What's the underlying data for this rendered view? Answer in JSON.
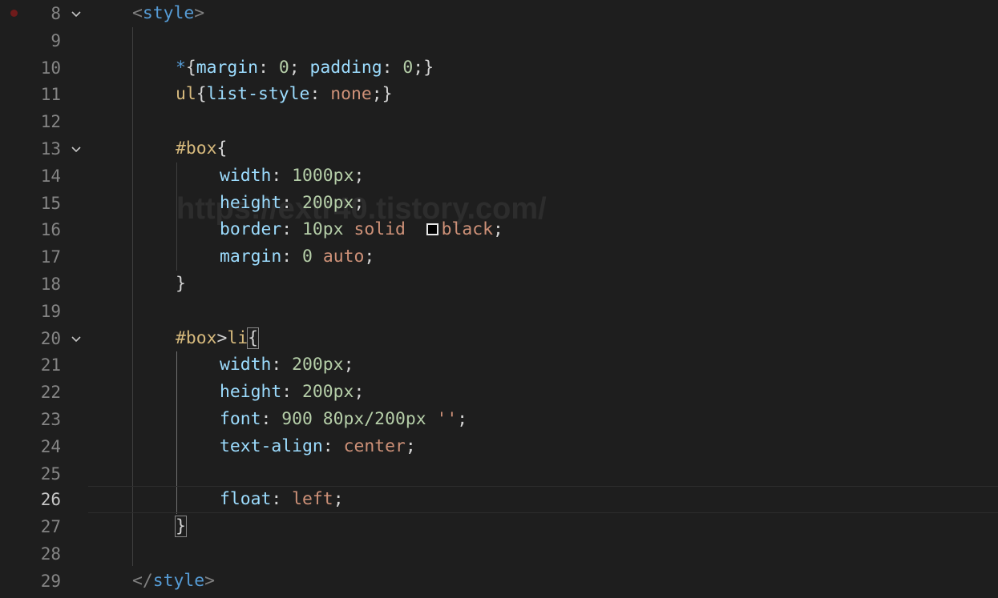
{
  "editor": {
    "active_line": "26",
    "watermark": "https://extr40.tistory.com/",
    "lines": [
      {
        "num": "8"
      },
      {
        "num": "9"
      },
      {
        "num": "10"
      },
      {
        "num": "11"
      },
      {
        "num": "12"
      },
      {
        "num": "13"
      },
      {
        "num": "14"
      },
      {
        "num": "15"
      },
      {
        "num": "16"
      },
      {
        "num": "17"
      },
      {
        "num": "18"
      },
      {
        "num": "19"
      },
      {
        "num": "20"
      },
      {
        "num": "21"
      },
      {
        "num": "22"
      },
      {
        "num": "23"
      },
      {
        "num": "24"
      },
      {
        "num": "25"
      },
      {
        "num": "26"
      },
      {
        "num": "27"
      },
      {
        "num": "28"
      },
      {
        "num": "29"
      }
    ],
    "tokens": {
      "l8_open": "<",
      "l8_tag": "style",
      "l8_close": ">",
      "l10_star": "*",
      "l10_b1": "{",
      "l10_p1": "margin",
      "l10_c1": ": ",
      "l10_n1": "0",
      "l10_s1": "; ",
      "l10_p2": "padding",
      "l10_c2": ": ",
      "l10_n2": "0",
      "l10_s2": ";",
      "l10_b2": "}",
      "l11_sel": "ul",
      "l11_b1": "{",
      "l11_p": "list-style",
      "l11_c": ": ",
      "l11_v": "none",
      "l11_s": ";",
      "l11_b2": "}",
      "l13_sel": "#box",
      "l13_b": "{",
      "l14_p": "width",
      "l14_c": ": ",
      "l14_n": "1000px",
      "l14_s": ";",
      "l15_p": "height",
      "l15_c": ": ",
      "l15_n": "200px",
      "l15_s": ";",
      "l16_p": "border",
      "l16_c": ": ",
      "l16_n": "10px",
      "l16_sp": " ",
      "l16_v1": "solid",
      "l16_sp2": " ",
      "l16_v2": "black",
      "l16_s": ";",
      "l17_p": "margin",
      "l17_c": ": ",
      "l17_n": "0",
      "l17_sp": " ",
      "l17_v": "auto",
      "l17_s": ";",
      "l18_b": "}",
      "l20_sel1": "#box",
      "l20_gt": ">",
      "l20_sel2": "li",
      "l20_b": "{",
      "l21_p": "width",
      "l21_c": ": ",
      "l21_n": "200px",
      "l21_s": ";",
      "l22_p": "height",
      "l22_c": ": ",
      "l22_n": "200px",
      "l22_s": ";",
      "l23_p": "font",
      "l23_c": ": ",
      "l23_n": "900 80px/200px",
      "l23_sp": " ",
      "l23_v": "''",
      "l23_s": ";",
      "l24_p": "text-align",
      "l24_c": ": ",
      "l24_v": "center",
      "l24_s": ";",
      "l26_p": "float",
      "l26_c": ": ",
      "l26_v": "left",
      "l26_s": ";",
      "l27_b": "}",
      "l29_open": "</",
      "l29_tag": "style",
      "l29_close": ">"
    },
    "colors": {
      "background": "#1e1e1e",
      "tag": "#569cd6",
      "selector": "#d7ba7d",
      "property": "#9cdcfe",
      "number": "#b5cea8",
      "string_value": "#ce9178",
      "line_number": "#858585"
    }
  }
}
